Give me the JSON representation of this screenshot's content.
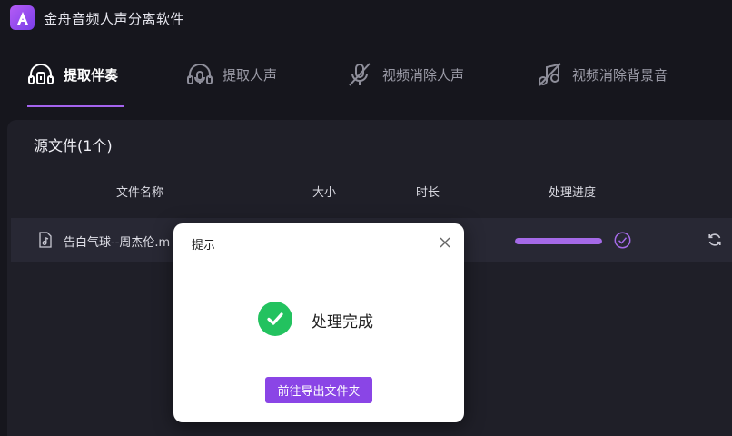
{
  "app": {
    "title": "金舟音频人声分离软件",
    "accent_color": "#a463ee"
  },
  "tabs": [
    {
      "label": "提取伴奏",
      "icon": "headphone-music-icon",
      "active": true
    },
    {
      "label": "提取人声",
      "icon": "headphone-mic-icon",
      "active": false
    },
    {
      "label": "视频消除人声",
      "icon": "mic-off-icon",
      "active": false
    },
    {
      "label": "视频消除背景音",
      "icon": "music-off-icon",
      "active": false
    }
  ],
  "source": {
    "title": "源文件(1个)",
    "columns": [
      "文件名称",
      "大小",
      "时长",
      "处理进度"
    ],
    "files": [
      {
        "name": "告白气球--周杰伦.m",
        "progress": 1.0,
        "status_icon": "check-circle-icon"
      }
    ]
  },
  "dialog": {
    "title": "提示",
    "message": "处理完成",
    "button_label": "前往导出文件夹",
    "success_color": "#23c25f"
  }
}
